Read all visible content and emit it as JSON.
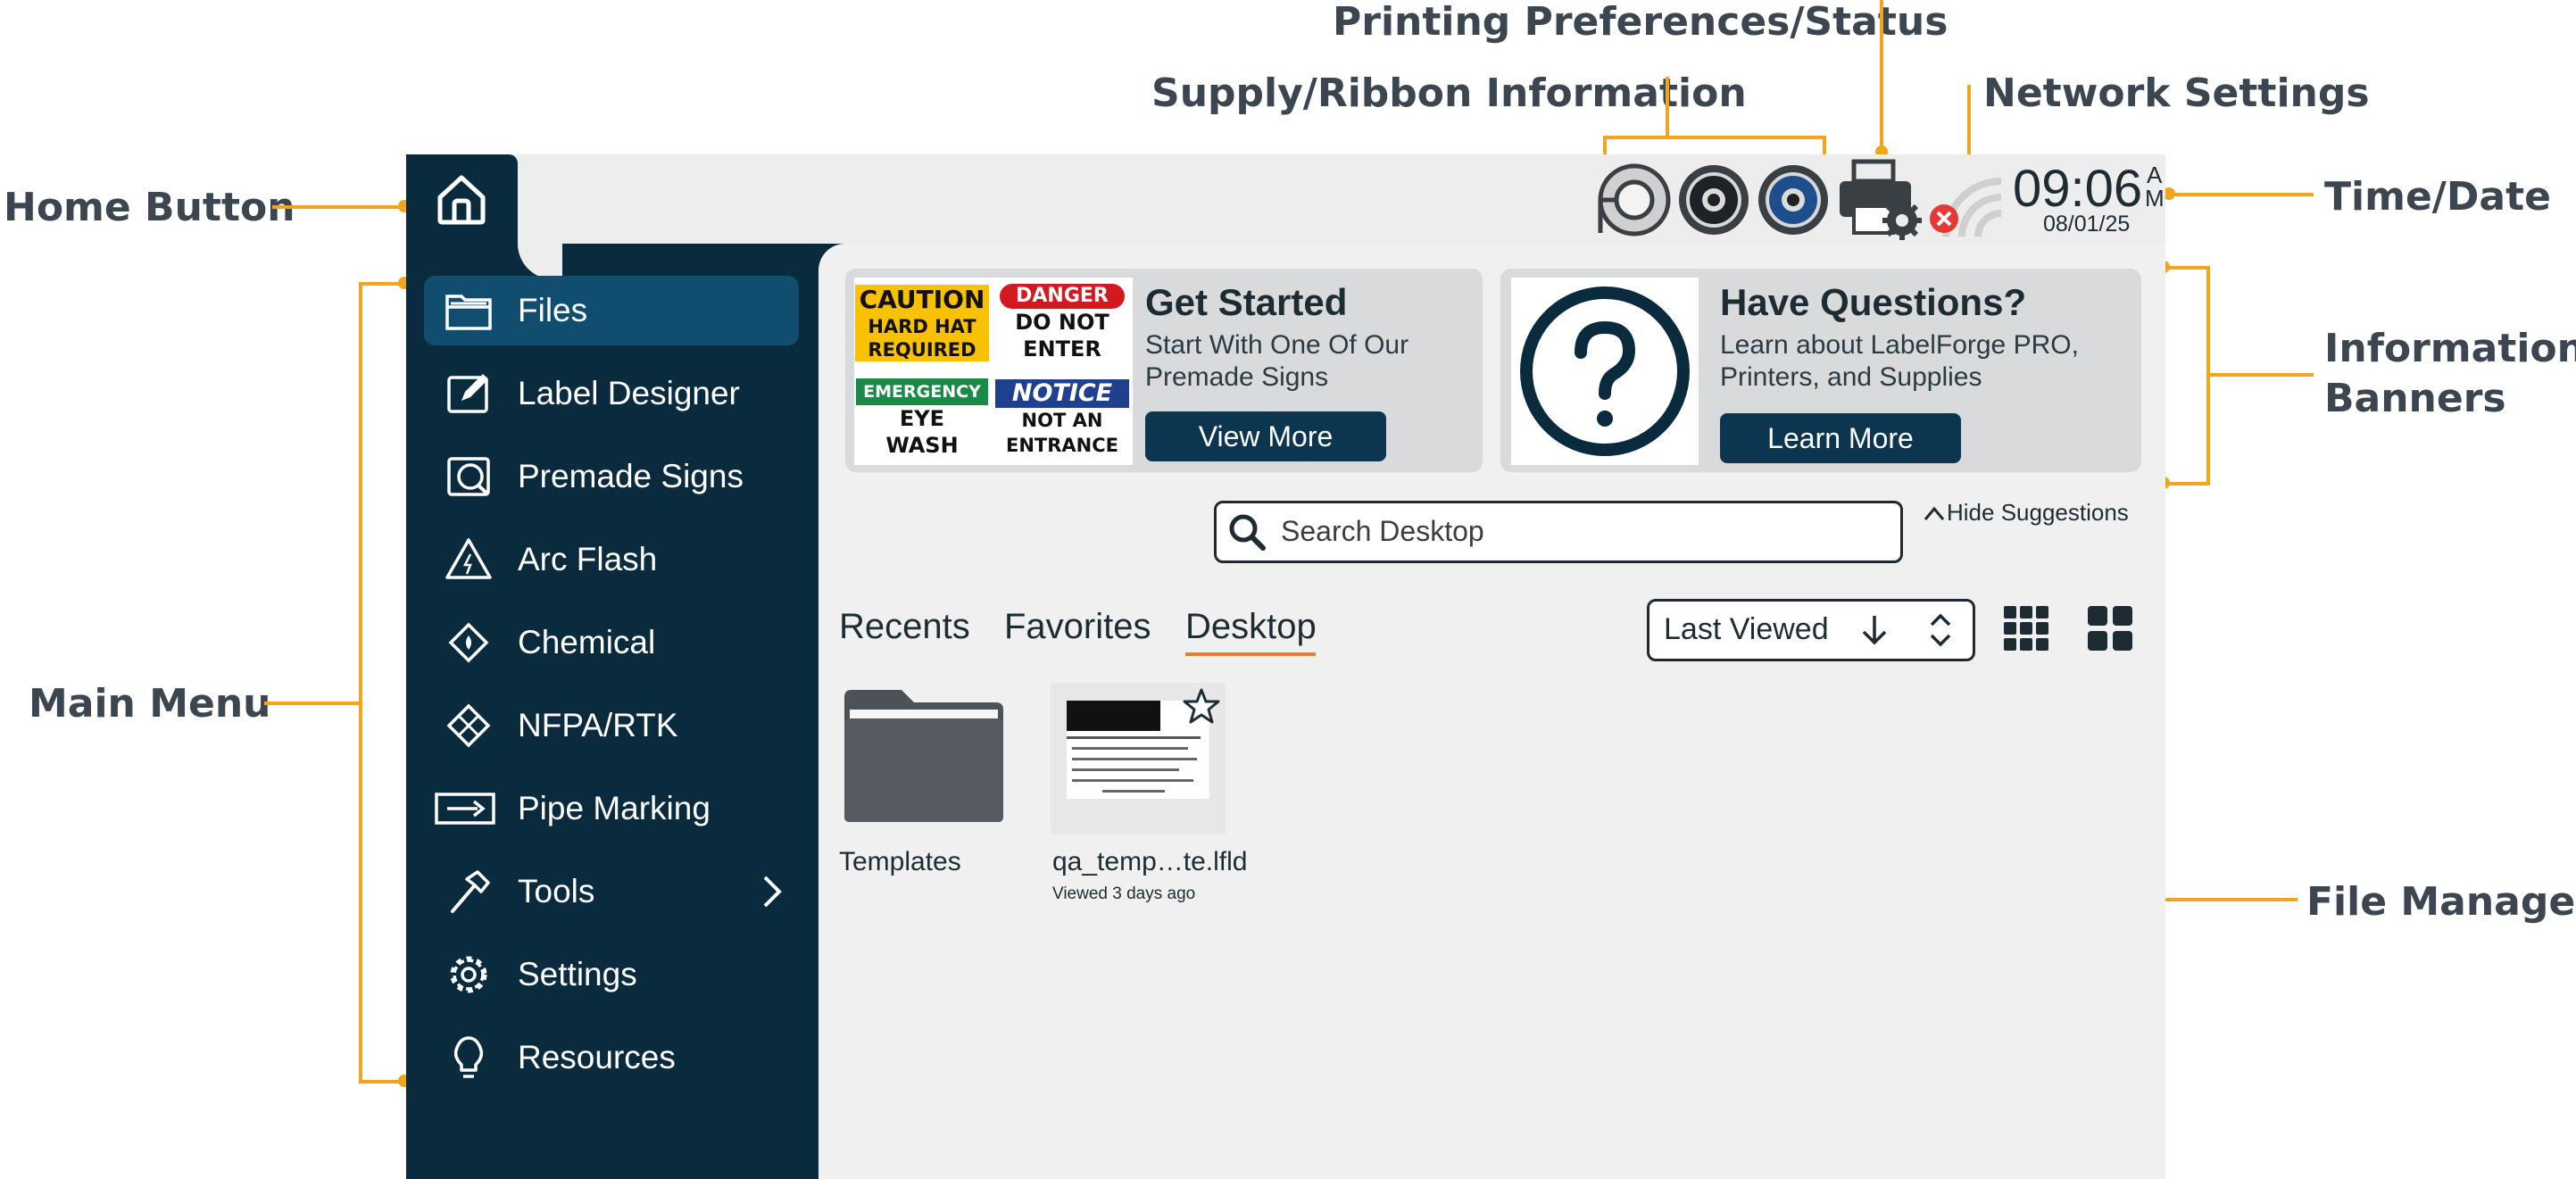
{
  "callouts": {
    "printing": "Printing Preferences/Status",
    "supply": "Supply/Ribbon Information",
    "network": "Network Settings",
    "home": "Home Button",
    "time_date": "Time/Date",
    "informational_1": "Informational",
    "informational_2": "Banners",
    "main_menu": "Main Menu",
    "file_manager": "File Manager"
  },
  "status": {
    "time": "09:06",
    "ampm_a": "A",
    "ampm_m": "M",
    "date": "08/01/25"
  },
  "sidebar": {
    "items": [
      {
        "label": "Files",
        "icon": "folder-icon",
        "active": true
      },
      {
        "label": "Label Designer",
        "icon": "label-edit-icon"
      },
      {
        "label": "Premade Signs",
        "icon": "premade-signs-icon"
      },
      {
        "label": "Arc Flash",
        "icon": "arc-flash-icon"
      },
      {
        "label": "Chemical",
        "icon": "chemical-icon"
      },
      {
        "label": "NFPA/RTK",
        "icon": "nfpa-icon"
      },
      {
        "label": "Pipe Marking",
        "icon": "pipe-marking-icon"
      },
      {
        "label": "Tools",
        "icon": "hammer-icon",
        "has_submenu": true
      },
      {
        "label": "Settings",
        "icon": "gear-icon"
      },
      {
        "label": "Resources",
        "icon": "lightbulb-icon"
      }
    ]
  },
  "banners": {
    "get_started": {
      "title": "Get Started",
      "line1": "Start With One Of Our",
      "line2": "Premade Signs",
      "button": "View More",
      "signs": {
        "caution": "CAUTION",
        "caution_text1": "HARD HAT",
        "caution_text2": "REQUIRED",
        "danger": "DANGER",
        "danger_text1": "DO NOT",
        "danger_text2": "ENTER",
        "emergency": "EMERGENCY",
        "emergency_text1": "EYE",
        "emergency_text2": "WASH",
        "notice": "NOTICE",
        "notice_text1": "NOT AN",
        "notice_text2": "ENTRANCE"
      }
    },
    "questions": {
      "title": "Have Questions?",
      "line1": "Learn about LabelForge PRO,",
      "line2": "Printers, and Supplies",
      "button": "Learn More"
    }
  },
  "search": {
    "placeholder": "Search Desktop",
    "hide_suggestions": "Hide Suggestions"
  },
  "tabs": [
    {
      "label": "Recents"
    },
    {
      "label": "Favorites"
    },
    {
      "label": "Desktop",
      "active": true
    }
  ],
  "sort": {
    "selected": "Last Viewed"
  },
  "files": [
    {
      "name": "Templates",
      "type": "folder"
    },
    {
      "name": "qa_temp…te.lfld",
      "type": "file",
      "subtitle": "Viewed 3 days ago"
    }
  ],
  "colors": {
    "sidebar": "#0a2b3d",
    "active_item": "#114d6f",
    "accent_callout": "#f2a51c",
    "tab_underline": "#f07a2e",
    "error_red": "#e53935"
  }
}
